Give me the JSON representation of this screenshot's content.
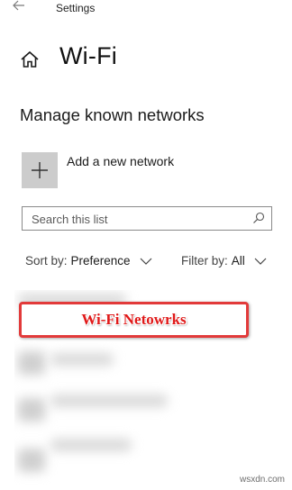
{
  "titlebar": {
    "back_icon": "back-arrow-icon",
    "title": "Settings"
  },
  "header": {
    "home_icon": "home-icon",
    "page_title": "Wi-Fi"
  },
  "section": {
    "title": "Manage known networks"
  },
  "add_network": {
    "icon": "plus-icon",
    "label": "Add a new network"
  },
  "search": {
    "placeholder": "Search this list",
    "icon": "search-icon"
  },
  "sort": {
    "label": "Sort by:",
    "value": "Preference"
  },
  "filter": {
    "label": "Filter by:",
    "value": "All"
  },
  "annotation": {
    "text": "Wi-Fi Netowrks",
    "color": "#e01919"
  },
  "watermark": {
    "text": "wsxdn.com"
  }
}
